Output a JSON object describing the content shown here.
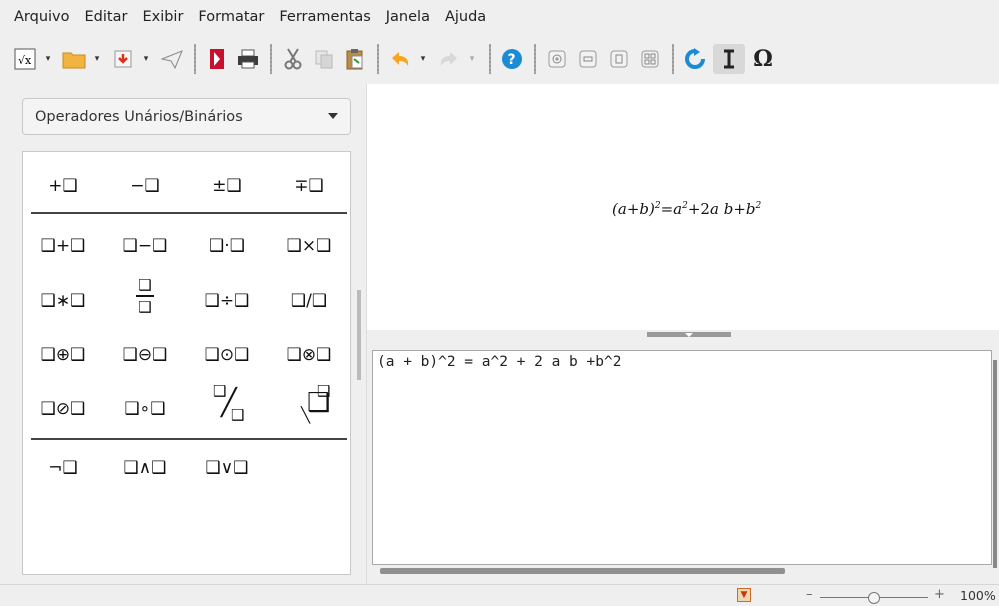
{
  "menu": [
    "Arquivo",
    "Editar",
    "Exibir",
    "Formatar",
    "Ferramentas",
    "Janela",
    "Ajuda"
  ],
  "toolbar": {
    "icons": [
      "formula-icon",
      "open-folder-icon",
      "save-icon",
      "send-icon",
      "pdf-icon",
      "print-icon",
      "cut-icon",
      "copy-icon",
      "paste-icon",
      "undo-icon",
      "redo-icon",
      "help-icon",
      "zoom-in-icon",
      "zoom-out-icon",
      "zoom-100-icon",
      "show-all-icon",
      "update-icon",
      "formula-cursor-icon",
      "symbols-icon"
    ]
  },
  "palette": {
    "category": "Operadores Unários/Binários",
    "row1": [
      "+❑",
      "−❑",
      "±❑",
      "∓❑"
    ],
    "row2": [
      "❑+❑",
      "❑−❑",
      "❑·❑",
      "❑×❑"
    ],
    "row3": [
      "❑∗❑",
      "❑",
      "❑",
      "❑÷❑",
      "❑/❑"
    ],
    "row4": [
      "❑⊕❑",
      "❑⊖❑",
      "❑⊙❑",
      "❑⊗❑"
    ],
    "row5": [
      "❑⊘❑",
      "❑∘❑",
      "❑",
      "╱",
      "❑",
      "❑",
      "╲",
      "❑"
    ],
    "row6": [
      "¬❑",
      "❑∧❑",
      "❑∨❑"
    ]
  },
  "preview": {
    "lparen": "(",
    "a": "a",
    "plus1": "+",
    "b": "b",
    "rparen": ")",
    "exp1": "2",
    "eq": "=",
    "a2": "a",
    "exp2": "2",
    "plus2": "+2",
    "ab": "a b",
    "plus3": "+",
    "b2": "b",
    "exp3": "2"
  },
  "editor": {
    "text": "(a + b)^2 = a^2 + 2 a b +b^2"
  },
  "status": {
    "zoom": "100%",
    "minus": "–",
    "plus": "+"
  },
  "colors": {
    "accent": "#1b8bd4",
    "pdf": "#c8102e",
    "status_icon": "#cc6a2a"
  }
}
